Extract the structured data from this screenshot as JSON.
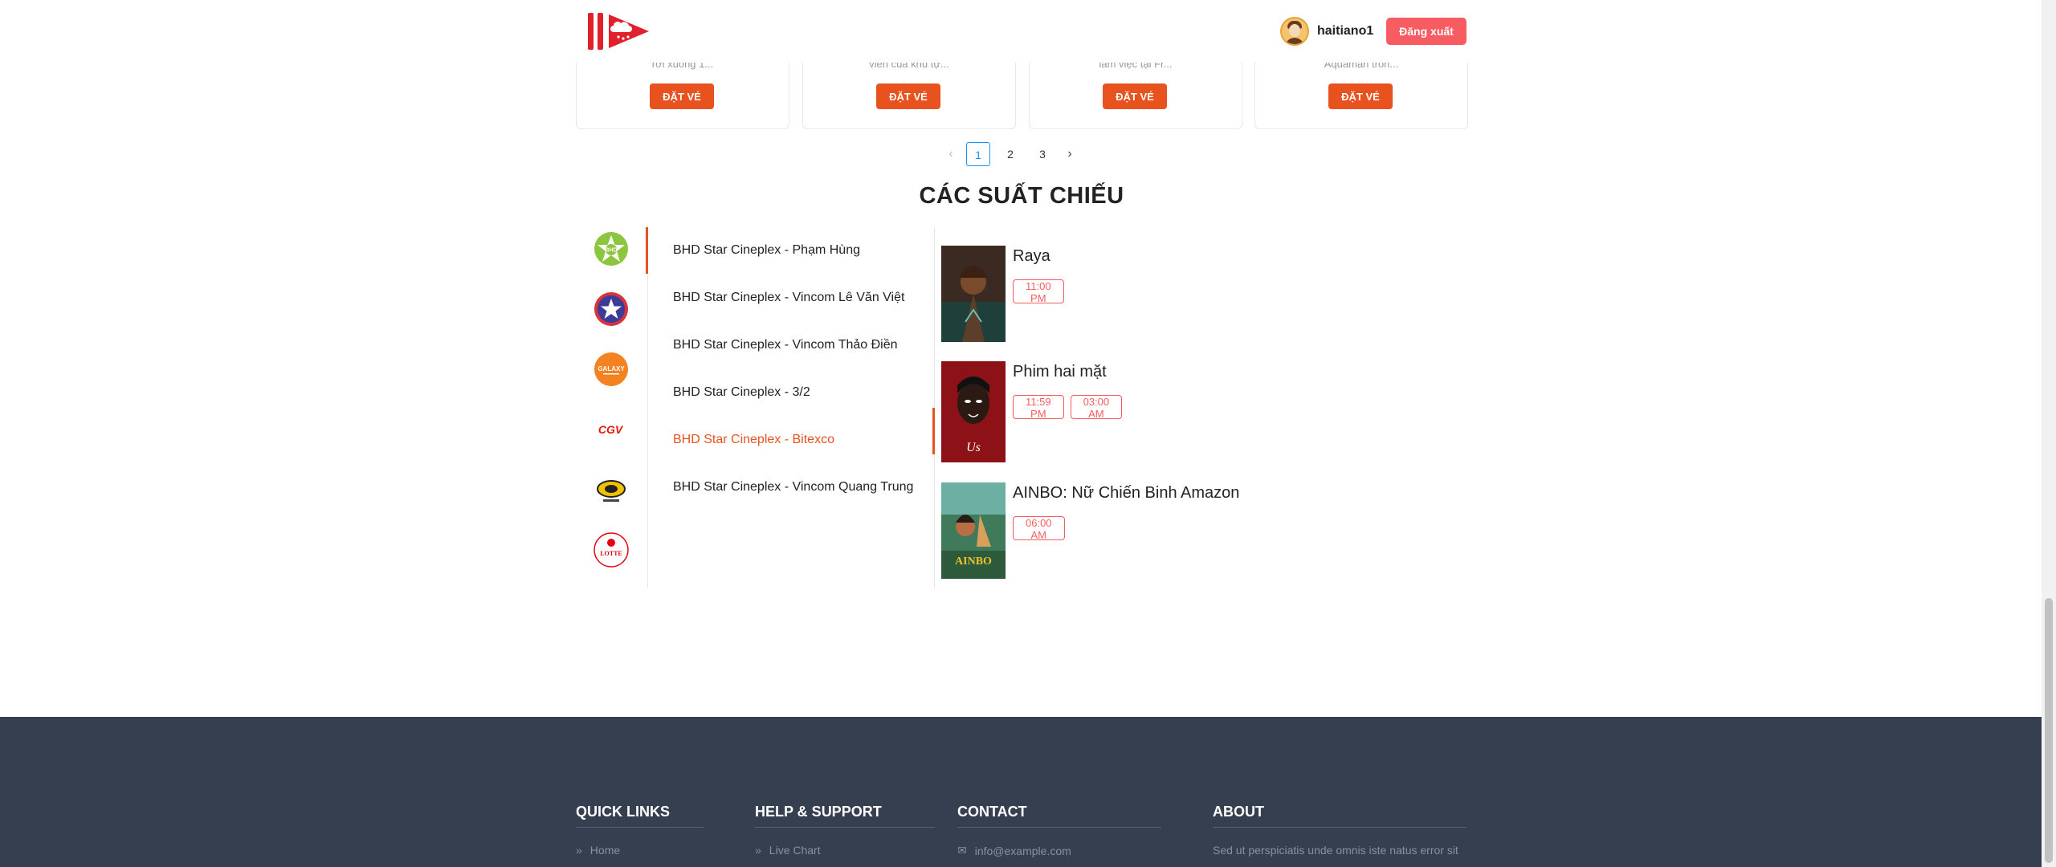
{
  "header": {
    "logo_icon": "movie-play-logo",
    "username": "haitiano1",
    "logout_label": "Đăng xuất"
  },
  "movie_cards": [
    {
      "desc": "rơi xuống 1...",
      "button": "ĐẶT VÉ"
    },
    {
      "desc": "viên của khu tự...",
      "button": "ĐẶT VÉ"
    },
    {
      "desc": "làm việc tại Fr...",
      "button": "ĐẶT VÉ"
    },
    {
      "desc": "Aquaman tròn...",
      "button": "ĐẶT VÉ"
    }
  ],
  "pagination": {
    "prev": "‹",
    "pages": [
      "1",
      "2",
      "3"
    ],
    "active_page": "1",
    "next": "›"
  },
  "showtimes": {
    "title": "CÁC SUẤT CHIẾU",
    "brands": [
      {
        "name": "BHD",
        "icon": "bhd-star-logo",
        "color": "#8cc63f"
      },
      {
        "name": "",
        "icon": "cinestar-logo",
        "color": "#3b3b98"
      },
      {
        "name": "GALAXY",
        "icon": "galaxy-logo",
        "color": "#f58220"
      },
      {
        "name": "CGV",
        "icon": "cgv-logo",
        "color": "#e71a0f"
      },
      {
        "name": "",
        "icon": "megags-logo",
        "color": "#d4a017"
      },
      {
        "name": "LOTTE",
        "icon": "lotte-cinema-logo",
        "color": "#e60012"
      }
    ],
    "active_brand": "BHD",
    "cinemas": [
      "BHD Star Cineplex - Phạm Hùng",
      "BHD Star Cineplex - Vincom Lê Văn Việt",
      "BHD Star Cineplex - Vincom Thảo Điền",
      "BHD Star Cineplex - 3/2",
      "BHD Star Cineplex - Bitexco",
      "BHD Star Cineplex - Vincom Quang Trung"
    ],
    "active_cinema": "BHD Star Cineplex - Bitexco",
    "movies": [
      {
        "title": "Raya",
        "times": [
          "11:00 PM"
        ]
      },
      {
        "title": "Phim hai mặt",
        "times": [
          "11:59 PM",
          "03:00 AM"
        ]
      },
      {
        "title": "AINBO: Nữ Chiến Binh Amazon",
        "times": [
          "06:00 AM"
        ]
      }
    ]
  },
  "footer": {
    "quick_links": {
      "title": "QUICK LINKS",
      "items": [
        "Home"
      ]
    },
    "help": {
      "title": "HELP & SUPPORT",
      "items": [
        "Live Chart"
      ]
    },
    "contact": {
      "title": "CONTACT",
      "items": [
        "info@example.com"
      ]
    },
    "about": {
      "title": "ABOUT",
      "text": "Sed ut perspiciatis unde omnis iste natus error sit"
    }
  },
  "colors": {
    "accent": "#e8521f",
    "logout": "#f75c62",
    "pagination_active": "#1890ff",
    "footer_bg": "#353f4f"
  }
}
